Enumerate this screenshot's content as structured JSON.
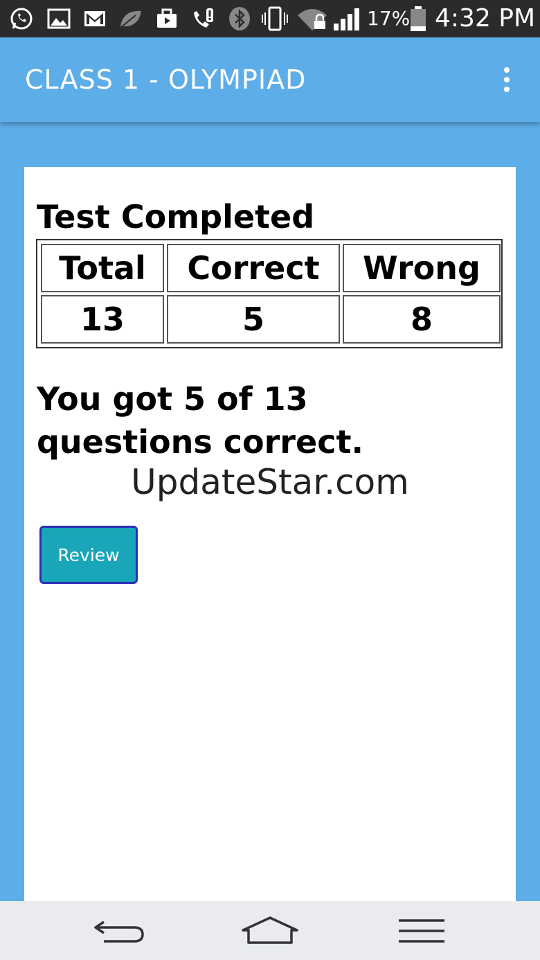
{
  "status_bar": {
    "icons": [
      "whatsapp-icon",
      "gallery-icon",
      "gmail-icon",
      "leaf-icon",
      "briefcase-icon",
      "call-alert-icon",
      "bluetooth-icon",
      "vibrate-icon",
      "wifi-lock-icon",
      "signal-icon",
      "battery-icon"
    ],
    "battery_percent": "17%",
    "time": "4:32 PM"
  },
  "action_bar": {
    "title": "CLASS 1 - OLYMPIAD",
    "menu_icon": "overflow-menu-icon"
  },
  "result": {
    "heading": "Test Completed",
    "table": {
      "headers": [
        "Total",
        "Correct",
        "Wrong"
      ],
      "values": [
        "13",
        "5",
        "8"
      ]
    },
    "summary": "You got 5 of 13 questions correct.",
    "watermark": "UpdateStar.com",
    "review_button": "Review"
  },
  "nav_bar": {
    "icons": [
      "back-icon",
      "home-icon",
      "menu-icon"
    ]
  },
  "colors": {
    "primary": "#5dade8",
    "button": "#19a6b8",
    "button_border": "#2a2fb5",
    "status_bar": "#2b2b2b"
  }
}
